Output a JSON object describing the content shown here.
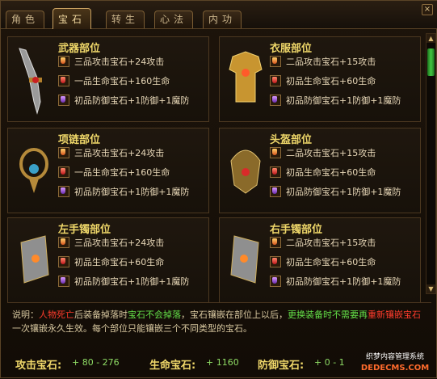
{
  "tabs": [
    {
      "label": "角色",
      "active": false
    },
    {
      "label": "宝石",
      "active": true
    },
    {
      "label": "转生",
      "active": false
    },
    {
      "label": "心法",
      "active": false
    },
    {
      "label": "内功",
      "active": false
    }
  ],
  "close_label": "×",
  "slots": [
    {
      "title": "武器部位",
      "lines": [
        {
          "gem": "orange",
          "text": "三品攻击宝石+24攻击"
        },
        {
          "gem": "red",
          "text": "一品生命宝石+160生命"
        },
        {
          "gem": "purple",
          "text": "初品防御宝石+1防御+1魔防"
        }
      ]
    },
    {
      "title": "衣服部位",
      "lines": [
        {
          "gem": "orange",
          "text": "二品攻击宝石+15攻击"
        },
        {
          "gem": "red",
          "text": "初品生命宝石+60生命"
        },
        {
          "gem": "purple",
          "text": "初品防御宝石+1防御+1魔防"
        }
      ]
    },
    {
      "title": "项链部位",
      "lines": [
        {
          "gem": "orange",
          "text": "三品攻击宝石+24攻击"
        },
        {
          "gem": "red",
          "text": "一品生命宝石+160生命"
        },
        {
          "gem": "purple",
          "text": "初品防御宝石+1防御+1魔防"
        }
      ]
    },
    {
      "title": "头盔部位",
      "lines": [
        {
          "gem": "orange",
          "text": "二品攻击宝石+15攻击"
        },
        {
          "gem": "red",
          "text": "初品生命宝石+60生命"
        },
        {
          "gem": "purple",
          "text": "初品防御宝石+1防御+1魔防"
        }
      ]
    },
    {
      "title": "左手镯部位",
      "lines": [
        {
          "gem": "orange",
          "text": "三品攻击宝石+24攻击"
        },
        {
          "gem": "red",
          "text": "初品生命宝石+60生命"
        },
        {
          "gem": "purple",
          "text": "初品防御宝石+1防御+1魔防"
        }
      ]
    },
    {
      "title": "右手镯部位",
      "lines": [
        {
          "gem": "orange",
          "text": "二品攻击宝石+15攻击"
        },
        {
          "gem": "red",
          "text": "初品生命宝石+60生命"
        },
        {
          "gem": "purple",
          "text": "初品防御宝石+1防御+1魔防"
        }
      ]
    }
  ],
  "description": {
    "p1": "说明：",
    "p2": "人物死亡",
    "p3": "后装备掉落时",
    "p4": "宝石不会掉落",
    "p5": "，宝石镶嵌在部位上以后，",
    "p6": "更换装备时不需要再",
    "p7": "重新镶嵌宝石",
    "p8": "一次镶嵌永久生效。每个部位只能镶嵌三个不同类型的宝石。"
  },
  "stats": {
    "attack_label": "攻击宝石:",
    "attack_value": "+ 80 - 276",
    "life_label": "生命宝石:",
    "life_value": "+ 1160",
    "defense_label": "防御宝石:",
    "defense_value": "+ 0 - 1"
  },
  "watermark": {
    "line1": "织梦内容管理系统",
    "line2": "DEDECMS.COM"
  },
  "colors": {
    "title": "#f0d86a",
    "red_text": "#ff3c2c",
    "green_text": "#64e048"
  }
}
